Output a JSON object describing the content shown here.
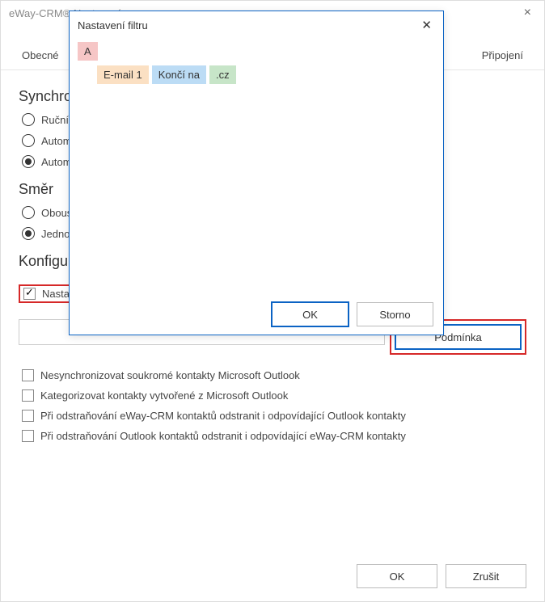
{
  "window": {
    "title": "eWay-CRM® Nastavení"
  },
  "tabs": {
    "general": "Obecné",
    "connection": "Připojení"
  },
  "sync": {
    "title": "Synchro",
    "radio_manual": "Ruční s",
    "radio_auto1": "Autom",
    "radio_auto2": "Autom"
  },
  "direction": {
    "title": "Směr",
    "radio_both": "Obous",
    "radio_one": "Jednos"
  },
  "config": {
    "title": "Konfigu",
    "set_condition": "Nastavit podmínku synchronizace z eWay-CRM do Microsoft Outlook",
    "condition_button": "Podmínka",
    "no_private": "Nesynchronizovat soukromé kontakty Microsoft Outlook",
    "categorize": "Kategorizovat kontakty vytvořené z Microsoft Outlook",
    "delete_eway": "Při odstraňování eWay-CRM kontaktů odstranit i odpovídající Outlook kontakty",
    "delete_outlook": "Při odstraňování Outlook kontaktů odstranit i odpovídající eWay-CRM kontakty"
  },
  "buttons": {
    "ok": "OK",
    "cancel": "Zrušit",
    "storno": "Storno"
  },
  "modal": {
    "title": "Nastavení filtru",
    "tagA": "A",
    "tag_field": "E-mail 1",
    "tag_op": "Končí na",
    "tag_val": ".cz"
  }
}
